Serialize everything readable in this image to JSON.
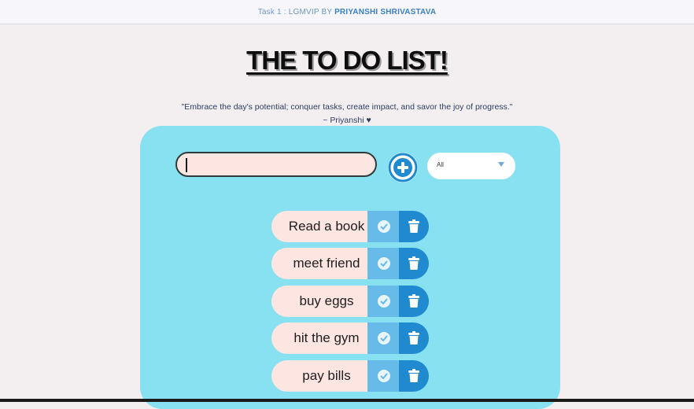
{
  "header": {
    "credit_prefix": "Task 1 : LGMVIP BY ",
    "credit_author": "PRIYANSHI SHRIVASTAVA"
  },
  "title": "THE TO DO LIST!",
  "quote": {
    "text": "\"Embrace the day's potential; conquer tasks, create impact, and savor the joy of progress.\"",
    "author": "~ Priyanshi ♥"
  },
  "form": {
    "input_value": "",
    "add_icon": "plus-circle-icon",
    "filter_selected": "All"
  },
  "todos": [
    {
      "label": "Read a book"
    },
    {
      "label": "meet friend"
    },
    {
      "label": "buy eggs"
    },
    {
      "label": "hit the gym"
    },
    {
      "label": "pay bills"
    }
  ],
  "colors": {
    "background": "#f3eff1",
    "card": "#87e1f0",
    "input_bg": "#fde6e1",
    "check_bg": "#67bbe8",
    "trash_bg": "#1f8ad0",
    "accent": "#1f8ad0"
  },
  "icons": {
    "complete": "check-circle-icon",
    "delete": "trash-icon",
    "filter": "caret-down-icon"
  }
}
